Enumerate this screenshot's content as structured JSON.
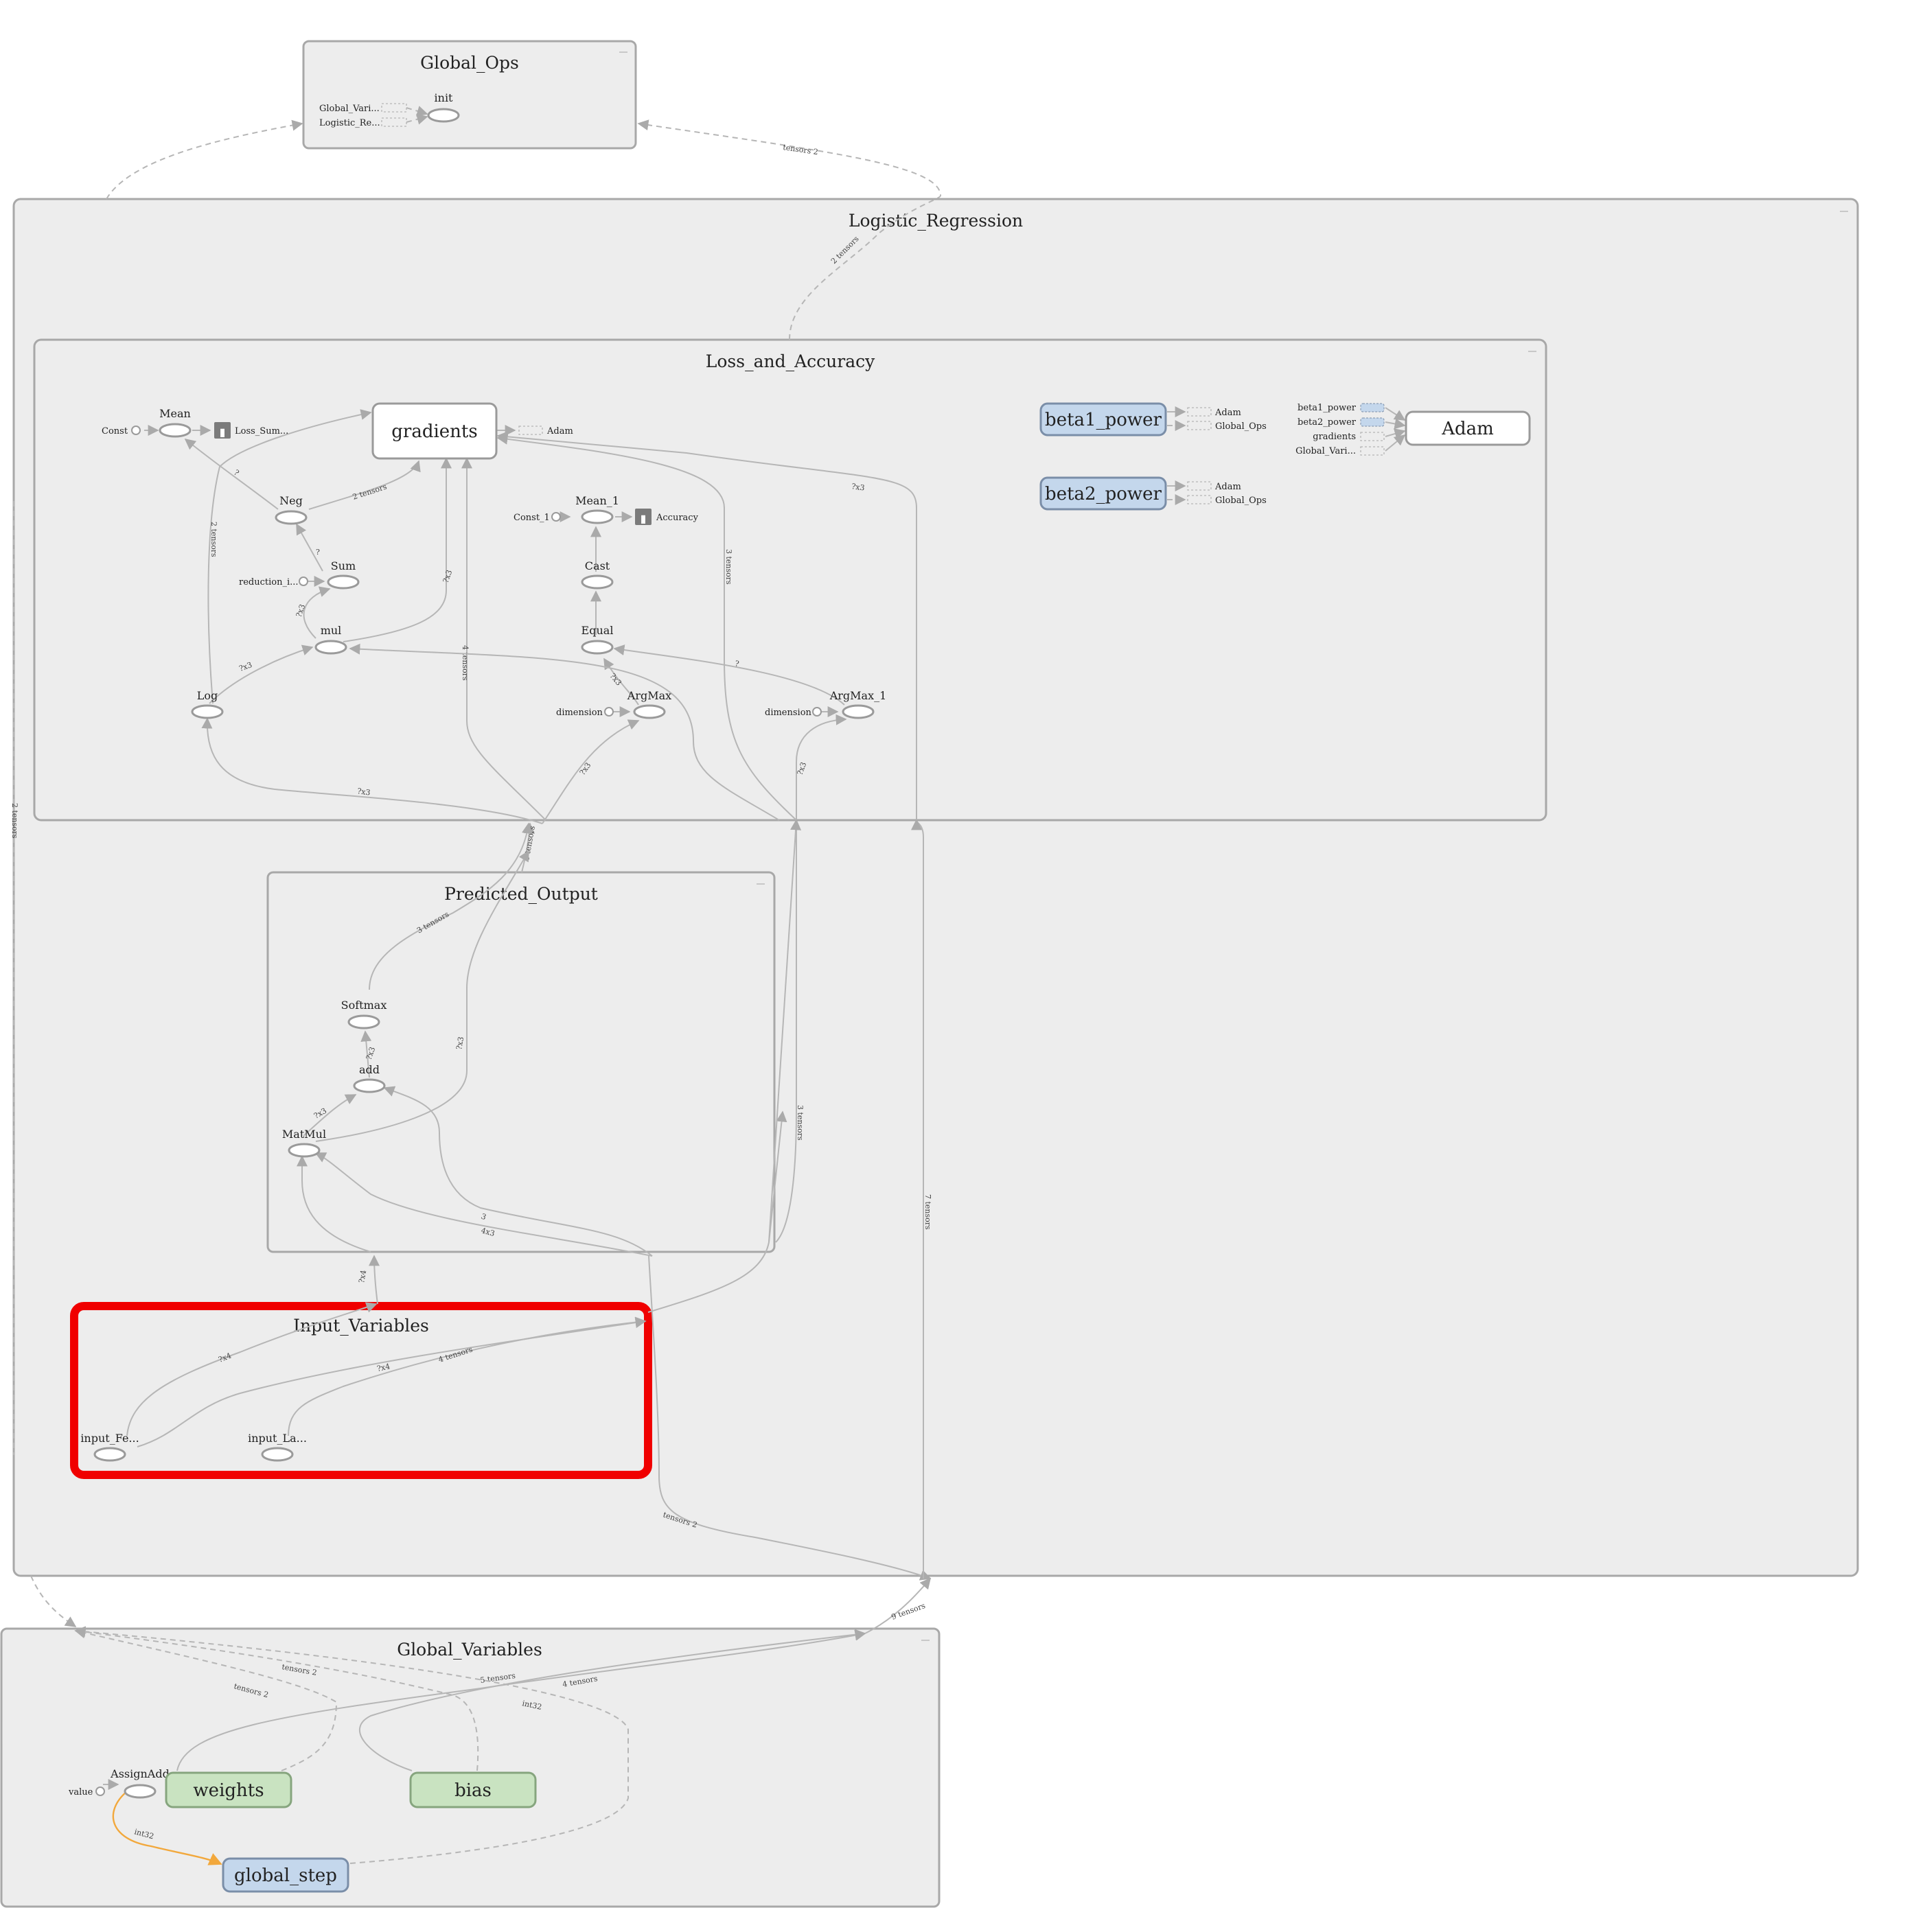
{
  "groups": {
    "global_ops": "Global_Ops",
    "logistic_regression": "Logistic_Regression",
    "loss_and_accuracy": "Loss_and_Accuracy",
    "predicted_output": "Predicted_Output",
    "input_variables": "Input_Variables",
    "global_variables": "Global_Variables"
  },
  "nodes": {
    "init": "init",
    "global_vari_ref": "Global_Vari...",
    "logistic_re_ref": "Logistic_Re...",
    "const": "Const",
    "mean": "Mean",
    "loss_sum": "Loss_Sum...",
    "gradients": "gradients",
    "adam_ref": "Adam",
    "neg": "Neg",
    "sum": "Sum",
    "reduction": "reduction_i...",
    "mul": "mul",
    "log": "Log",
    "const_1": "Const_1",
    "mean_1": "Mean_1",
    "accuracy": "Accuracy",
    "cast": "Cast",
    "equal": "Equal",
    "argmax": "ArgMax",
    "argmax_1": "ArgMax_1",
    "dimension": "dimension",
    "dimension_2": "dimension",
    "beta1_power": "beta1_power",
    "beta2_power": "beta2_power",
    "adam": "Adam",
    "b1_ref_adam": "Adam",
    "b1_ref_global": "Global_Ops",
    "b2_ref_adam": "Adam",
    "b2_ref_global": "Global_Ops",
    "adam_in_beta1": "beta1_power",
    "adam_in_beta2": "beta2_power",
    "adam_in_gradients": "gradients",
    "adam_in_global": "Global_Vari...",
    "softmax": "Softmax",
    "add": "add",
    "matmul": "MatMul",
    "input_fe": "input_Fe...",
    "input_la": "input_La...",
    "assignadd": "AssignAdd",
    "value": "value",
    "weights": "weights",
    "bias": "bias",
    "global_step": "global_step"
  },
  "edge_labels": {
    "global_ops_in": "tensors 2",
    "lr_to_global": "2 tensors",
    "log_grad": "2 tensors",
    "neg_grad": "2 tensors",
    "mul_grad": "?x3",
    "log_mul": "?x3",
    "sum_mul": "?x3",
    "sum_neg": "?",
    "neg_mean": "?",
    "grad_4t": "4 tensors",
    "grad_3t": "3 tensors",
    "grad_right": "?x3",
    "argmax_eq": "?x3",
    "argmax1_eq": "?",
    "loss_log": "?x3",
    "to_argmax": "?x3",
    "to_argmax1": "?x3",
    "po_out": "6 tensors",
    "softmax_out": "3 tensors",
    "add_softmax": "?x3",
    "matmul_add": "?x3",
    "matmul_out": "?x3",
    "iv_matmul": "?x4",
    "bias_add": "3",
    "weights_matmul": "4x3",
    "iv_a": "?x4",
    "iv_b": "?x4",
    "iv_c": "4 tensors",
    "lr_left": "2 tensors",
    "iv_to_gv": "tensors 2",
    "lr_right_3t": "3 tensors",
    "lr_right_7t": "7 tensors",
    "gv_9t": "9 tensors",
    "gv_w": "tensors 2",
    "gv_b": "tensors 2",
    "gv_5t": "5 tensors",
    "gv_4t": "4 tensors",
    "gv_int": "int32",
    "assign_int": "int32"
  }
}
